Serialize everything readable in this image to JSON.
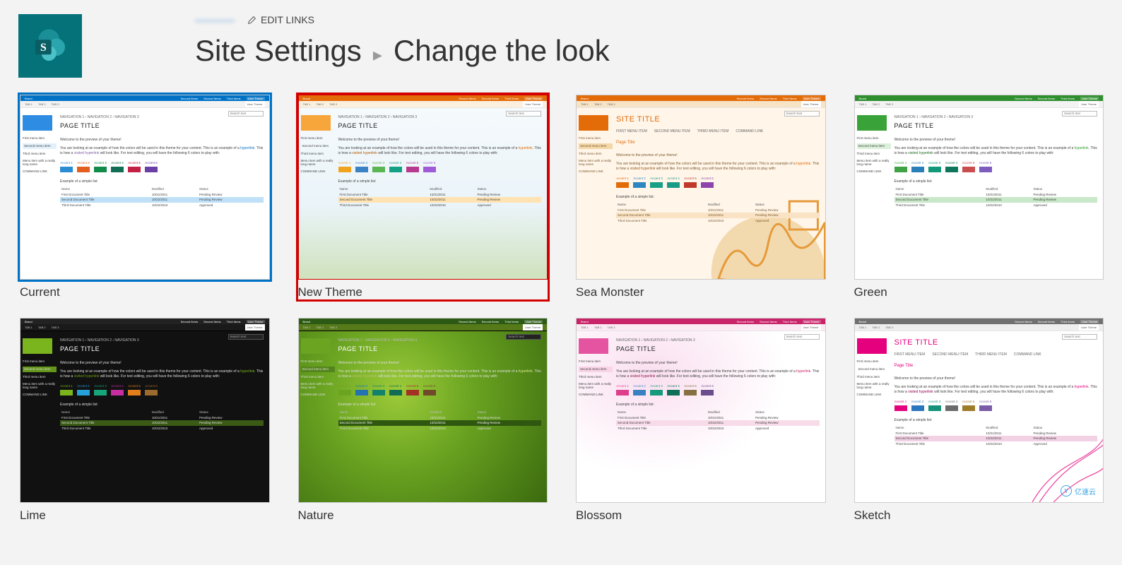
{
  "header": {
    "edit_links": "EDIT LINKS",
    "title_primary": "Site Settings",
    "title_secondary": "Change the look"
  },
  "themes": [
    {
      "key": "current",
      "label": "Current",
      "style": "blue"
    },
    {
      "key": "newtheme",
      "label": "New Theme",
      "style": "orange"
    },
    {
      "key": "seamonster",
      "label": "Sea Monster",
      "style": "tealimg"
    },
    {
      "key": "green",
      "label": "Green",
      "style": "green"
    },
    {
      "key": "lime",
      "label": "Lime",
      "style": "dark"
    },
    {
      "key": "nature",
      "label": "Nature",
      "style": "nature"
    },
    {
      "key": "blossom",
      "label": "Blossom",
      "style": "pink"
    },
    {
      "key": "sketch",
      "label": "Sketch",
      "style": "sketch"
    }
  ],
  "preview": {
    "brand": "Brand",
    "brand_links": [
      "Second Items",
      "Second Items",
      "Third Items",
      "User Theme"
    ],
    "ribbon_tabs": [
      "TAB 1",
      "TAB 2",
      "TAB 3"
    ],
    "nav_path": "NAVIGATION 1  ›  NAVIGATION 2  ›  NAVIGATION 3",
    "page_title": "PAGE TITLE",
    "site_title": "SITE TITLE",
    "site_nav_links": [
      "FIRST MENU ITEM",
      "SECOND MENU ITEM",
      "THIRD MENU ITEM",
      "COMMAND LINK"
    ],
    "search": "Search text",
    "sidebar_items": [
      "First menu item",
      "Second menu item",
      "Third menu item",
      "Menu item with a really long name",
      "COMMAND LINK"
    ],
    "welcome": "Welcome to the preview of your theme!",
    "paragraph_pre": "You are looking at an example of how the colors will be used in this theme for your content. This is an example of a ",
    "hyperlink": "hyperlink",
    "paragraph_mid": ". This is how a ",
    "visited_hyperlink": "visited hyperlink",
    "paragraph_post": " will look like. For text editing, you will have the following 6 colors to play with:",
    "accent_labels": [
      "Accent 1",
      "Accent 2",
      "Accent 3",
      "Accent 4",
      "Accent 5",
      "Accent 6"
    ],
    "example_header": "Example of a simple list:",
    "table": {
      "columns": [
        "Name",
        "Modified",
        "Status"
      ],
      "rows": [
        [
          "First Document Title",
          "10/21/2011",
          "Pending Review"
        ],
        [
          "Second Document Title",
          "10/22/2011",
          "Pending Review"
        ],
        [
          "Third Document Title",
          "10/22/2010",
          "Approved"
        ]
      ]
    },
    "watermark": "亿速云"
  },
  "styles": {
    "blue": {
      "bar": "#0072c6",
      "block": "#2e8de3",
      "accents": [
        "#2a8dd4",
        "#e35f20",
        "#128a4a",
        "#0f6e53",
        "#c42245",
        "#6b40a6"
      ],
      "bg": "#ffffff",
      "fg": "#444",
      "selrow": "#bfe0f7",
      "link": "#0072c6",
      "vlink": "#8064a2",
      "ribbon": "#f3f3f3",
      "side_sel": "#e2f0fb"
    },
    "orange": {
      "bar": "#e36c09",
      "block": "#f6a63b",
      "accents": [
        "#f0a41e",
        "#3a82c4",
        "#5ab552",
        "#14a085",
        "#b73a8e",
        "#a05bd6"
      ],
      "bg": "#ffffff",
      "fg": "#444",
      "selrow": "#ffe3b2",
      "link": "#e36c09",
      "vlink": "#b05a07",
      "ribbon": "#fbf0de",
      "side_sel": ""
    },
    "tealimg": {
      "bar": "#e36c09",
      "block": "#e36c09",
      "accents": [
        "#e36c09",
        "#2e86c1",
        "#16a085",
        "#189c87",
        "#c0392b",
        "#8e44ad"
      ],
      "bg": "#fff5e9",
      "fg": "#7c5a2e",
      "selrow": "#f9e3c4",
      "link": "#e36c09",
      "vlink": "#9a5c1a",
      "ribbon": "#f7e3c6",
      "side_sel": "#f3d7a8"
    },
    "green": {
      "bar": "#2f8f2f",
      "block": "#39a339",
      "accents": [
        "#3fa244",
        "#2980b9",
        "#14987a",
        "#0f765c",
        "#c94d4d",
        "#7d5bbf"
      ],
      "bg": "#ffffff",
      "fg": "#444",
      "selrow": "#c9e8c9",
      "link": "#2f9e2f",
      "vlink": "#1f6f1f",
      "ribbon": "#f3f3f3",
      "side_sel": "#daf0da"
    },
    "dark": {
      "bar": "#222222",
      "block": "#7AB51D",
      "accents": [
        "#7ab51d",
        "#26a0da",
        "#16a67a",
        "#c62ea3",
        "#e37f1b",
        "#9d6a2e"
      ],
      "bg": "#111111",
      "fg": "#dddddd",
      "selrow": "#3a5a16",
      "link": "#7ab51d",
      "vlink": "#6aa015",
      "ribbon": "#1a1a1a",
      "side_sel": "#63951a"
    },
    "nature": {
      "bar": "#2c5a14",
      "block": "#6aa421",
      "accents": [
        "#6aa421",
        "#2273b0",
        "#12836a",
        "#116c54",
        "#a33022",
        "#6f4b2a"
      ],
      "bg": "#3c6a12",
      "fg": "#eeeeee",
      "selrow": "#2f5710",
      "link": "#d9e48a",
      "vlink": "#b9c06a",
      "ribbon": "#567a1a",
      "side_sel": "#54841c"
    },
    "pink": {
      "bar": "#c9246a",
      "block": "#e554a0",
      "accents": [
        "#df3e8c",
        "#3a80c3",
        "#159a7c",
        "#0f6f59",
        "#866f40",
        "#6b4d8d"
      ],
      "bg": "#ffffff",
      "fg": "#444",
      "selrow": "#f7dbe8",
      "link": "#c9246a",
      "vlink": "#8b194a",
      "ribbon": "#fbeaf3",
      "side_sel": "#f8d4e6"
    },
    "sketch": {
      "bar": "#707070",
      "block": "#e5007d",
      "accents": [
        "#e5007d",
        "#2b77bf",
        "#14937a",
        "#6b6b6b",
        "#9d7c2a",
        "#7b5ba7"
      ],
      "bg": "#ffffff",
      "fg": "#444",
      "selrow": "#f3d1e4",
      "link": "#e5007d",
      "vlink": "#9b0055",
      "ribbon": "#eeeeee",
      "side_sel": ""
    }
  }
}
